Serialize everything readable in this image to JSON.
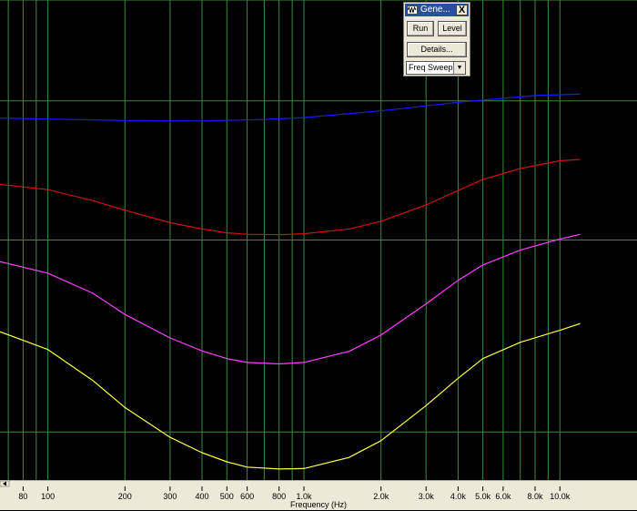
{
  "chart_data": {
    "type": "line",
    "xscale": "log",
    "xlim": [
      65,
      20000
    ],
    "xlabel": "Frequency (Hz)",
    "grid": true,
    "x_ticks": [
      {
        "value": 80,
        "label": "80"
      },
      {
        "value": 100,
        "label": "100"
      },
      {
        "value": 200,
        "label": "200"
      },
      {
        "value": 300,
        "label": "300"
      },
      {
        "value": 400,
        "label": "400"
      },
      {
        "value": 500,
        "label": "500"
      },
      {
        "value": 600,
        "label": "600"
      },
      {
        "value": 800,
        "label": "800"
      },
      {
        "value": 1000,
        "label": "1.0k"
      },
      {
        "value": 2000,
        "label": "2.0k"
      },
      {
        "value": 3000,
        "label": "3.0k"
      },
      {
        "value": 4000,
        "label": "4.0k"
      },
      {
        "value": 5000,
        "label": "5.0k"
      },
      {
        "value": 6000,
        "label": "6.0k"
      },
      {
        "value": 8000,
        "label": "8.0k"
      },
      {
        "value": 10000,
        "label": "10.0k"
      }
    ],
    "minor_x_gridlines": [
      70,
      90,
      700,
      900,
      7000,
      9000
    ],
    "ylim": [
      0,
      10
    ],
    "y_gridlines": [
      1,
      5,
      7.9,
      10
    ],
    "series": [
      {
        "color": "#1a1aff",
        "x": [
          65,
          100,
          200,
          400,
          700,
          1000,
          2000,
          4000,
          8000,
          12000
        ],
        "y": [
          7.54,
          7.52,
          7.49,
          7.48,
          7.51,
          7.55,
          7.69,
          7.87,
          8.01,
          8.04
        ]
      },
      {
        "color": "#d01010",
        "x": [
          65,
          100,
          150,
          200,
          300,
          400,
          500,
          600,
          800,
          1000,
          1500,
          2000,
          3000,
          4000,
          5000,
          7000,
          10000,
          12000
        ],
        "y": [
          6.16,
          6.05,
          5.82,
          5.62,
          5.36,
          5.23,
          5.15,
          5.12,
          5.11,
          5.13,
          5.23,
          5.39,
          5.73,
          6.03,
          6.26,
          6.49,
          6.65,
          6.68
        ]
      },
      {
        "color": "#ff40ff",
        "x": [
          65,
          100,
          150,
          200,
          300,
          400,
          500,
          600,
          800,
          1000,
          1500,
          2000,
          3000,
          4000,
          5000,
          7000,
          10000,
          12000
        ],
        "y": [
          4.55,
          4.31,
          3.89,
          3.45,
          2.96,
          2.69,
          2.53,
          2.45,
          2.42,
          2.45,
          2.68,
          3.02,
          3.67,
          4.16,
          4.48,
          4.79,
          5.02,
          5.12
        ]
      },
      {
        "color": "#ffff40",
        "x": [
          65,
          100,
          150,
          200,
          300,
          400,
          500,
          600,
          800,
          1000,
          1500,
          2000,
          3000,
          4000,
          5000,
          7000,
          10000,
          12000
        ],
        "y": [
          3.09,
          2.72,
          2.07,
          1.51,
          0.89,
          0.57,
          0.38,
          0.27,
          0.23,
          0.24,
          0.47,
          0.82,
          1.55,
          2.12,
          2.53,
          2.87,
          3.12,
          3.26
        ]
      }
    ]
  },
  "generator": {
    "title": "Gene...",
    "close_label": "X",
    "run_label": "Run",
    "level_label": "Level",
    "details_label": "Details...",
    "mode_value": "Freq Sweep"
  }
}
